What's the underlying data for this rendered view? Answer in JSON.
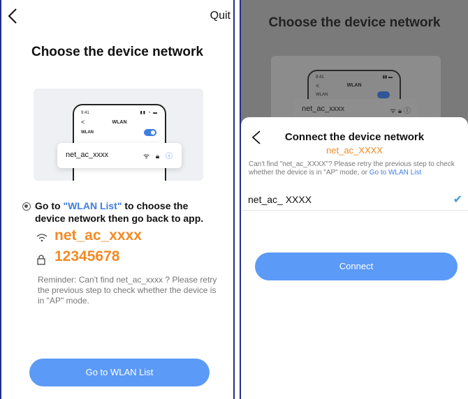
{
  "left": {
    "quit_label": "Quit",
    "title": "Choose the device network",
    "illustration": {
      "time": "9:41",
      "header": "WLAN",
      "wlan_label": "WLAN",
      "network_name": "net_ac_xxxx"
    },
    "instruction_prefix": "Go to ",
    "instruction_link": "\"WLAN List\"",
    "instruction_suffix": " to choose the device network then go back to app.",
    "ssid": "net_ac_xxxx",
    "password": "12345678",
    "reminder": "Reminder: Can't find net_ac_xxxx ? Please retry the previous step to check whether the device is in \"AP\" mode.",
    "button_label": "Go to WLAN List"
  },
  "right": {
    "title": "Choose the device network",
    "illustration": {
      "time": "9:41",
      "header": "WLAN",
      "wlan_label": "WLAN",
      "network_name": "net_ac_xxxx"
    },
    "sheet": {
      "title": "Connect the device network",
      "subtitle": "net_ac_XXXX",
      "note_text": "Can't find \"net_ac_XXXX\"? Please retry the previous step to check whether the device is in \"AP\" mode, or ",
      "note_link": "Go to WLAN List",
      "network_item": "net_ac_ XXXX",
      "button_label": "Connect"
    }
  },
  "colors": {
    "accent": "#5b9af6",
    "link": "#3f7de0",
    "highlight": "#f28a25",
    "frame": "#1f2f8a"
  },
  "icons": {
    "back": "chevron-left-icon",
    "wifi": "wifi-icon",
    "lock": "lock-icon",
    "check": "checkmark-icon",
    "radio": "radio-selected-icon"
  }
}
